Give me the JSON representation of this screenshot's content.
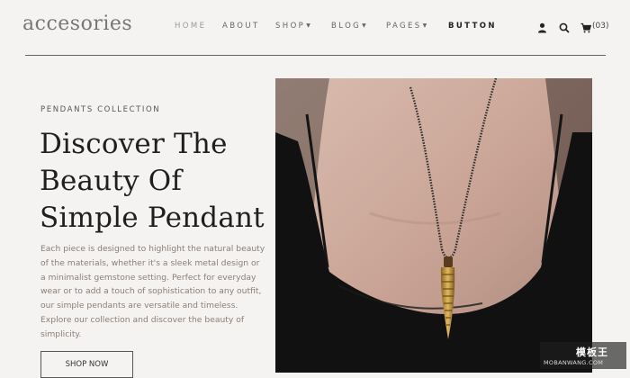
{
  "header": {
    "logo": "accesories",
    "nav": [
      {
        "label": "HOME",
        "dropdown": false
      },
      {
        "label": "ABOUT",
        "dropdown": false
      },
      {
        "label": "SHOP",
        "dropdown": true
      },
      {
        "label": "BLOG",
        "dropdown": true
      },
      {
        "label": "PAGES",
        "dropdown": true
      },
      {
        "label": "BUTTON",
        "dropdown": false
      }
    ],
    "cart_count": "(03)",
    "icons": [
      "user-icon",
      "search-icon",
      "cart-icon"
    ]
  },
  "hero": {
    "eyebrow": "PENDANTS COLLECTION",
    "headline": "Discover The Beauty Of Simple Pendant",
    "description": "Each piece is designed to highlight the natural beauty of the materials, whether it's a sleek metal design or a minimalist gemstone setting. Perfect for everyday wear or to add a touch of sophistication to any outfit, our simple pendants are versatile and timeless. Explore our collection and discover the beauty of simplicity.",
    "cta": "SHOP NOW"
  },
  "watermark": {
    "title": "模板王",
    "url": "MOBANWANG.COM"
  },
  "colors": {
    "background": "#f4f3f1",
    "text": "#1f1f1f",
    "muted": "#8a7e78",
    "dress": "#121212",
    "pendant": "#c9a04a"
  }
}
